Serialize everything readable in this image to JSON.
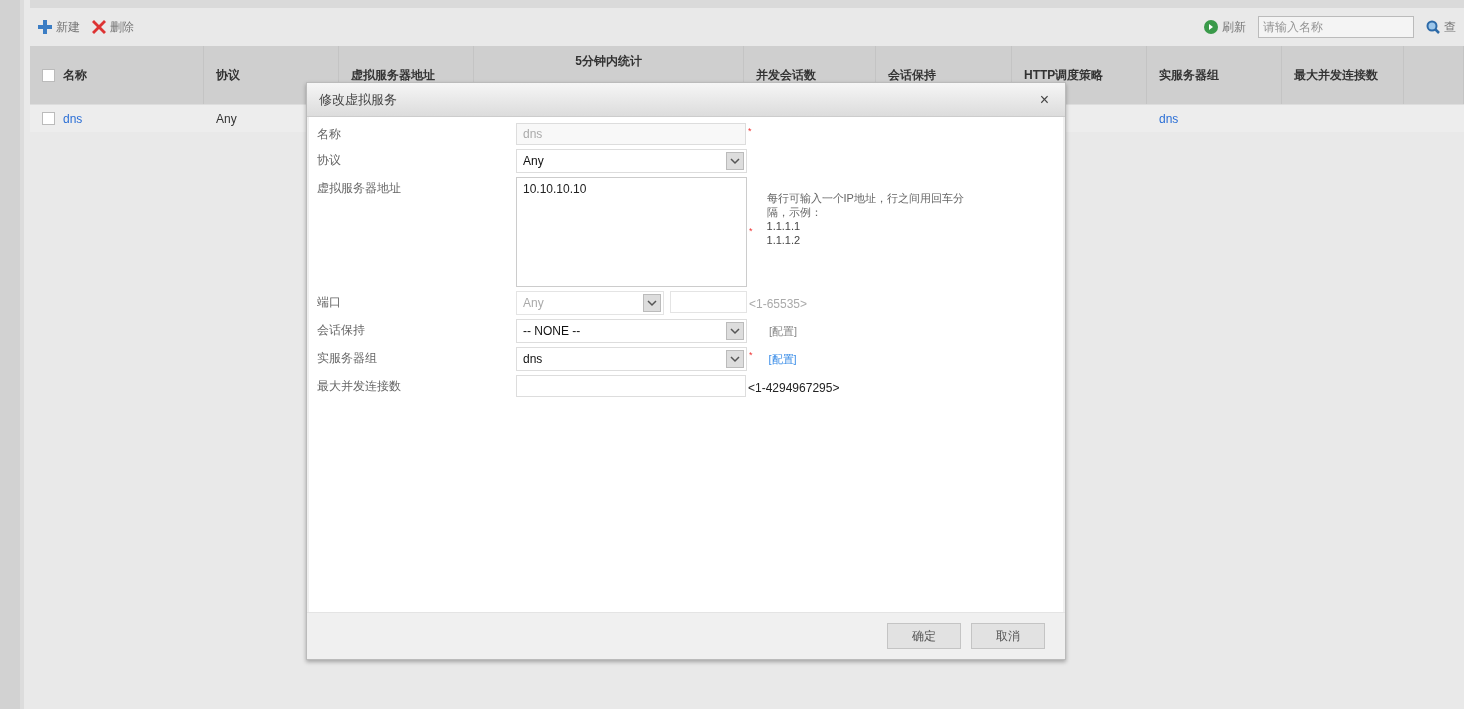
{
  "toolbar": {
    "buttons": [
      {
        "kind": "add",
        "label": "新建"
      },
      {
        "kind": "delete",
        "label": "删除"
      }
    ],
    "refresh": "刷新",
    "search": {
      "placeholder": "请输入名称"
    },
    "query": "查"
  },
  "table": {
    "columns": [
      {
        "label": "名称",
        "kind": "check",
        "checked": false
      },
      {
        "label": "协议"
      },
      {
        "label": "虚拟服务器地址"
      },
      {
        "label": "5分钟内统计"
      },
      {
        "label": "并发会话数"
      },
      {
        "label": "会话保持"
      },
      {
        "label": "HTTP调度策略"
      },
      {
        "label": "实服务器组"
      },
      {
        "label": "最大并发连接数"
      },
      {}
    ],
    "rows": [
      {
        "checked": false,
        "name": "dns",
        "protocol": "Any",
        "server_group": "dns"
      }
    ]
  },
  "dialog": {
    "title": "修改虚拟服务",
    "close": "×",
    "fields": [
      {
        "kind": "text",
        "label": "名称",
        "value": "dns",
        "disabled": true,
        "mark": "*"
      },
      {
        "kind": "select",
        "label": "协议",
        "value": "Any"
      },
      {
        "kind": "textarea",
        "label": "虚拟服务器地址",
        "value": "10.10.10.10",
        "mark": "*",
        "hint": [
          "每行可输入一个IP地址，行之间用回车分隔，示例：",
          "1.1.1.1",
          "1.1.1.2"
        ]
      },
      {
        "kind": "port",
        "label": "端口",
        "value": "Any",
        "disabled": true,
        "range": "<1-65535>"
      },
      {
        "kind": "select",
        "label": "会话保持",
        "value": "-- NONE --",
        "link": "[配置]",
        "link_enabled": false
      },
      {
        "kind": "select",
        "label": "实服务器组",
        "value": "dns",
        "mark": "*",
        "link": "[配置]",
        "link_enabled": true
      },
      {
        "kind": "text",
        "label": "最大并发连接数",
        "range": "<1-4294967295>"
      }
    ],
    "buttons": [
      "确定",
      "取消"
    ]
  }
}
